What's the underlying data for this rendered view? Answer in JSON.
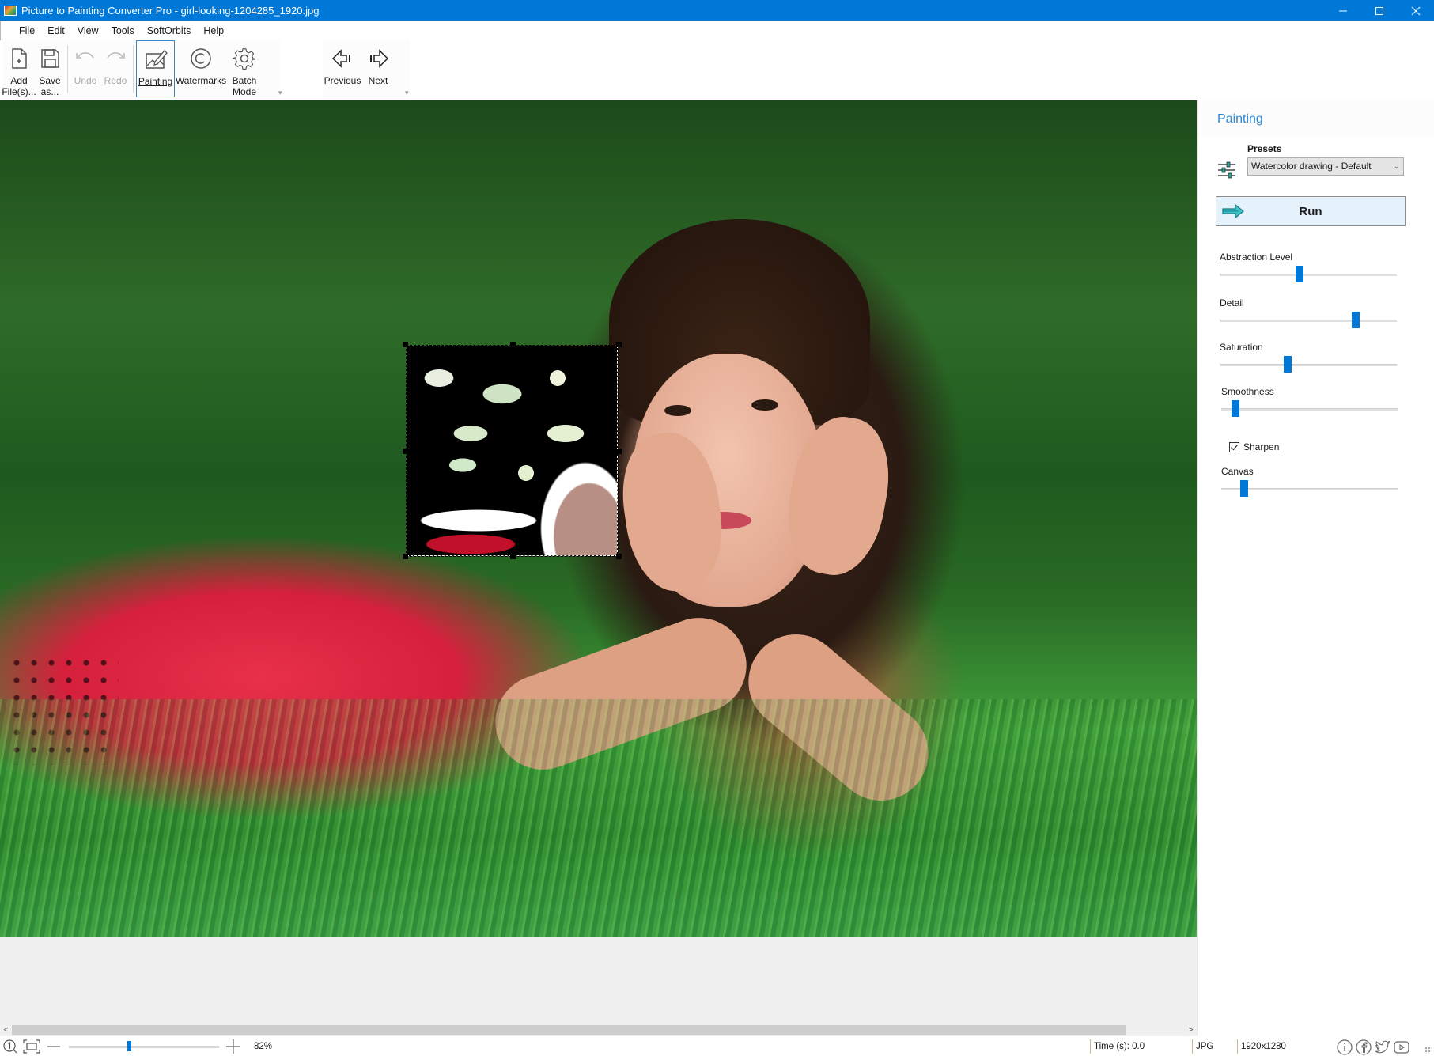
{
  "window": {
    "title": "Picture to Painting Converter Pro - girl-looking-1204285_1920.jpg",
    "controls": [
      "minimize-icon",
      "maximize-icon",
      "close-icon"
    ]
  },
  "menu": {
    "items": [
      {
        "label": "File",
        "accel": "F"
      },
      {
        "label": "Edit",
        "accel": "E"
      },
      {
        "label": "View",
        "accel": "V"
      },
      {
        "label": "Tools",
        "accel": "T"
      },
      {
        "label": "SoftOrbits",
        "accel": ""
      },
      {
        "label": "Help",
        "accel": "H"
      }
    ]
  },
  "toolbar": {
    "add_files": {
      "line1": "Add",
      "line2": "File(s)...",
      "icon": "add-file-icon"
    },
    "save_as": {
      "line1": "Save",
      "line2": "as...",
      "icon": "save-icon"
    },
    "undo": {
      "label": "Undo",
      "icon": "undo-icon",
      "enabled": false
    },
    "redo": {
      "label": "Redo",
      "icon": "redo-icon",
      "enabled": false
    },
    "painting": {
      "label": "Painting",
      "icon": "painting-icon",
      "active": true
    },
    "watermarks": {
      "label": "Watermarks",
      "icon": "copyright-icon"
    },
    "batch_mode": {
      "line1": "Batch",
      "line2": "Mode",
      "icon": "gear-icon"
    },
    "previous": {
      "label": "Previous",
      "icon": "previous-arrow-icon"
    },
    "next": {
      "label": "Next",
      "icon": "next-arrow-icon"
    }
  },
  "panel": {
    "title": "Painting",
    "presets_label": "Presets",
    "preset_selected": "Watercolor drawing - Default",
    "run_label": "Run",
    "sliders": [
      {
        "label": "Abstraction Level",
        "value_fraction": 0.45
      },
      {
        "label": "Detail",
        "value_fraction": 0.78
      },
      {
        "label": "Saturation",
        "value_fraction": 0.38
      },
      {
        "label": "Smoothness",
        "value_fraction": 0.06
      },
      {
        "label": "Canvas",
        "value_fraction": 0.11
      }
    ],
    "sharpen": {
      "label": "Sharpen",
      "checked": true
    }
  },
  "status": {
    "zoom_percent": "82%",
    "zoom_slider_fraction": 0.4,
    "time": "Time (s): 0.0",
    "format": "JPG",
    "dimensions": "1920x1280",
    "scroll_thumb_fraction": 0.95
  },
  "accent_color": "#0078d7"
}
